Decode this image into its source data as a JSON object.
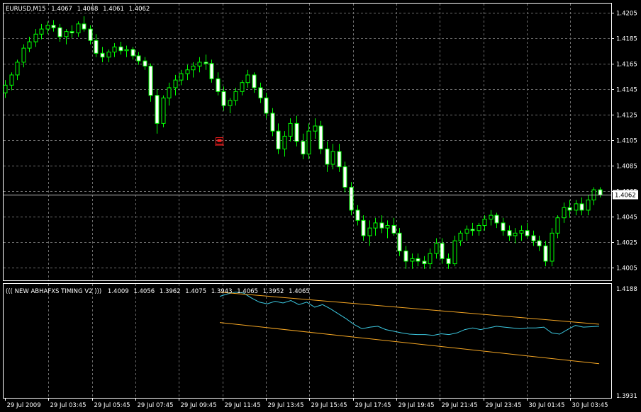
{
  "colors": {
    "background": "#000000",
    "frame": "#ffffff",
    "grid": "#6e6e6e",
    "candle": "#00ff00",
    "bid_line": "#c0c0c0",
    "indicator_line": "#3cc8e0",
    "channel_line": "#f5a623",
    "object_marker": "#ff2020"
  },
  "main_panel": {
    "header": {
      "symbol": "EURUSD,M15",
      "open": "1.4067",
      "high": "1.4068",
      "low": "1.4061",
      "close": "1.4062"
    },
    "price_ticks": [
      "1.4205",
      "1.4185",
      "1.4165",
      "1.4145",
      "1.4125",
      "1.4105",
      "1.4085",
      "1.4065",
      "1.4045",
      "1.4025",
      "1.4005"
    ],
    "current_price_label": "1.4062",
    "object_marker_icon": "alert-marker-icon"
  },
  "indicator_panel": {
    "header": {
      "name": "((( NEW ABHAFXS TIMING V2 )))",
      "values": [
        "1.4009",
        "1.4056",
        "1.3962",
        "1.4075",
        "1.3943",
        "1.4065",
        "1.3952",
        "1.4065"
      ]
    },
    "scale_ticks": [
      "1.4188",
      "1.3931"
    ]
  },
  "time_axis": [
    "29 Jul 2009",
    "29 Jul 03:45",
    "29 Jul 05:45",
    "29 Jul 07:45",
    "29 Jul 09:45",
    "29 Jul 11:45",
    "29 Jul 13:45",
    "29 Jul 15:45",
    "29 Jul 17:45",
    "29 Jul 19:45",
    "29 Jul 21:45",
    "29 Jul 23:45",
    "30 Jul 01:45",
    "30 Jul 03:45"
  ],
  "chart_data": {
    "type": "candlestick",
    "symbol": "EURUSD",
    "timeframe": "M15",
    "ylim": [
      1.3995,
      1.4212
    ],
    "current_price": 1.4062,
    "candles": [
      [
        1.4142,
        1.4152,
        1.4138,
        1.4148
      ],
      [
        1.4148,
        1.4158,
        1.4144,
        1.4156
      ],
      [
        1.4156,
        1.4168,
        1.4152,
        1.4166
      ],
      [
        1.4166,
        1.418,
        1.4162,
        1.4177
      ],
      [
        1.4177,
        1.4186,
        1.4174,
        1.4182
      ],
      [
        1.4182,
        1.4192,
        1.4178,
        1.4188
      ],
      [
        1.4188,
        1.4196,
        1.4184,
        1.4192
      ],
      [
        1.4192,
        1.4198,
        1.4188,
        1.4195
      ],
      [
        1.4195,
        1.4199,
        1.419,
        1.4193
      ],
      [
        1.4193,
        1.4196,
        1.4182,
        1.4186
      ],
      [
        1.4186,
        1.4192,
        1.418,
        1.419
      ],
      [
        1.419,
        1.4195,
        1.4185,
        1.4189
      ],
      [
        1.4189,
        1.4198,
        1.4186,
        1.4196
      ],
      [
        1.4196,
        1.4202,
        1.419,
        1.4192
      ],
      [
        1.4192,
        1.4195,
        1.418,
        1.4183
      ],
      [
        1.4183,
        1.4188,
        1.417,
        1.4173
      ],
      [
        1.4173,
        1.4178,
        1.4166,
        1.417
      ],
      [
        1.417,
        1.4176,
        1.4166,
        1.4174
      ],
      [
        1.4174,
        1.4181,
        1.417,
        1.4178
      ],
      [
        1.4178,
        1.4182,
        1.4172,
        1.4175
      ],
      [
        1.4175,
        1.4179,
        1.417,
        1.4176
      ],
      [
        1.4176,
        1.4178,
        1.4168,
        1.4171
      ],
      [
        1.4171,
        1.4174,
        1.4164,
        1.4167
      ],
      [
        1.4167,
        1.417,
        1.416,
        1.4163
      ],
      [
        1.4163,
        1.4165,
        1.4135,
        1.414
      ],
      [
        1.414,
        1.4145,
        1.411,
        1.4118
      ],
      [
        1.4118,
        1.414,
        1.4115,
        1.4138
      ],
      [
        1.4138,
        1.415,
        1.4132,
        1.4146
      ],
      [
        1.4146,
        1.4156,
        1.414,
        1.4152
      ],
      [
        1.4152,
        1.416,
        1.4148,
        1.4157
      ],
      [
        1.4157,
        1.4164,
        1.4152,
        1.416
      ],
      [
        1.416,
        1.4166,
        1.4154,
        1.4163
      ],
      [
        1.4163,
        1.417,
        1.4158,
        1.4166
      ],
      [
        1.4166,
        1.4172,
        1.416,
        1.4165
      ],
      [
        1.4165,
        1.4168,
        1.415,
        1.4153
      ],
      [
        1.4153,
        1.4158,
        1.414,
        1.4143
      ],
      [
        1.4143,
        1.4147,
        1.4128,
        1.4132
      ],
      [
        1.4132,
        1.4138,
        1.4126,
        1.4136
      ],
      [
        1.4136,
        1.4146,
        1.4132,
        1.4143
      ],
      [
        1.4143,
        1.4152,
        1.414,
        1.415
      ],
      [
        1.415,
        1.416,
        1.4146,
        1.4156
      ],
      [
        1.4156,
        1.4158,
        1.4142,
        1.4146
      ],
      [
        1.4146,
        1.415,
        1.4134,
        1.4138
      ],
      [
        1.4138,
        1.4142,
        1.4122,
        1.4126
      ],
      [
        1.4126,
        1.413,
        1.4108,
        1.4112
      ],
      [
        1.4112,
        1.4118,
        1.4094,
        1.4098
      ],
      [
        1.4098,
        1.4112,
        1.4092,
        1.4108
      ],
      [
        1.4108,
        1.4122,
        1.4104,
        1.4118
      ],
      [
        1.4118,
        1.4124,
        1.41,
        1.4104
      ],
      [
        1.4104,
        1.411,
        1.409,
        1.4094
      ],
      [
        1.4094,
        1.4118,
        1.409,
        1.4112
      ],
      [
        1.4112,
        1.4122,
        1.4106,
        1.4116
      ],
      [
        1.4116,
        1.412,
        1.4094,
        1.4098
      ],
      [
        1.4098,
        1.4104,
        1.408,
        1.4086
      ],
      [
        1.4086,
        1.4102,
        1.4082,
        1.4096
      ],
      [
        1.4096,
        1.4102,
        1.408,
        1.4084
      ],
      [
        1.4084,
        1.4088,
        1.4064,
        1.4068
      ],
      [
        1.4068,
        1.4072,
        1.4046,
        1.405
      ],
      [
        1.405,
        1.4054,
        1.4038,
        1.4042
      ],
      [
        1.4042,
        1.4046,
        1.4026,
        1.403
      ],
      [
        1.403,
        1.4042,
        1.4022,
        1.4036
      ],
      [
        1.4036,
        1.4044,
        1.403,
        1.404
      ],
      [
        1.404,
        1.4046,
        1.4032,
        1.4036
      ],
      [
        1.4036,
        1.4042,
        1.4028,
        1.4038
      ],
      [
        1.4038,
        1.4044,
        1.403,
        1.4032
      ],
      [
        1.4032,
        1.4036,
        1.4014,
        1.4018
      ],
      [
        1.4018,
        1.4022,
        1.4004,
        1.401
      ],
      [
        1.401,
        1.4016,
        1.4004,
        1.4012
      ],
      [
        1.4012,
        1.4016,
        1.4006,
        1.401
      ],
      [
        1.401,
        1.4014,
        1.4004,
        1.4008
      ],
      [
        1.4008,
        1.402,
        1.4004,
        1.4016
      ],
      [
        1.4016,
        1.4028,
        1.4012,
        1.4024
      ],
      [
        1.4024,
        1.4028,
        1.4008,
        1.4012
      ],
      [
        1.4012,
        1.4016,
        1.4004,
        1.4008
      ],
      [
        1.4008,
        1.403,
        1.4006,
        1.4026
      ],
      [
        1.4026,
        1.4034,
        1.4022,
        1.4032
      ],
      [
        1.4032,
        1.4038,
        1.4026,
        1.4035
      ],
      [
        1.4035,
        1.404,
        1.403,
        1.4034
      ],
      [
        1.4034,
        1.404,
        1.403,
        1.4038
      ],
      [
        1.4038,
        1.4046,
        1.4034,
        1.4043
      ],
      [
        1.4043,
        1.405,
        1.4038,
        1.4046
      ],
      [
        1.4046,
        1.4048,
        1.4036,
        1.404
      ],
      [
        1.404,
        1.4044,
        1.403,
        1.4034
      ],
      [
        1.4034,
        1.4038,
        1.4026,
        1.403
      ],
      [
        1.403,
        1.4036,
        1.4024,
        1.4032
      ],
      [
        1.4032,
        1.4038,
        1.4026,
        1.4034
      ],
      [
        1.4034,
        1.404,
        1.4028,
        1.403
      ],
      [
        1.403,
        1.4034,
        1.4022,
        1.4026
      ],
      [
        1.4026,
        1.403,
        1.4018,
        1.4022
      ],
      [
        1.4022,
        1.4026,
        1.4006,
        1.401
      ],
      [
        1.401,
        1.4036,
        1.4006,
        1.4032
      ],
      [
        1.4032,
        1.4046,
        1.4028,
        1.4044
      ],
      [
        1.4044,
        1.4056,
        1.404,
        1.4052
      ],
      [
        1.4052,
        1.4058,
        1.4044,
        1.405
      ],
      [
        1.405,
        1.4058,
        1.4046,
        1.4055
      ],
      [
        1.4055,
        1.406,
        1.4046,
        1.405
      ],
      [
        1.405,
        1.4062,
        1.4046,
        1.4058
      ],
      [
        1.4058,
        1.4068,
        1.4054,
        1.4066
      ],
      [
        1.4066,
        1.4068,
        1.406,
        1.4062
      ]
    ],
    "indicator": {
      "name": "((( NEW ABHAFXS TIMING V2 )))",
      "ylim": [
        1.3931,
        1.4188
      ],
      "line": [
        1.417,
        1.4176,
        1.418,
        1.4178,
        1.4166,
        1.4156,
        1.4152,
        1.4158,
        1.4154,
        1.416,
        1.415,
        1.4156,
        1.4144,
        1.415,
        1.414,
        1.4128,
        1.4116,
        1.4102,
        1.4092,
        1.4096,
        1.4098,
        1.409,
        1.4086,
        1.4082,
        1.4079,
        1.4078,
        1.4078,
        1.4076,
        1.408,
        1.4078,
        1.4082,
        1.409,
        1.4094,
        1.409,
        1.4094,
        1.4098,
        1.4096,
        1.4094,
        1.4092,
        1.4094,
        1.4094,
        1.4096,
        1.4082,
        1.4079,
        1.409,
        1.41,
        1.4096,
        1.4097,
        1.4098
      ],
      "channel_upper": [
        1.418,
        1.4103
      ],
      "channel_lower": [
        1.4107,
        1.4008
      ]
    }
  }
}
